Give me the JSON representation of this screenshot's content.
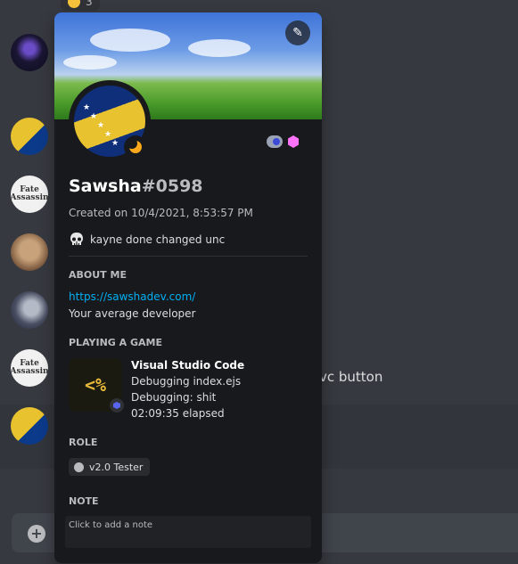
{
  "background": {
    "reaction_count": "3",
    "avatars": [
      "bosnia-flag-avatar",
      "dark-character-avatar",
      "fate-assassin-avatar",
      "cat-avatar",
      "person-avatar",
      "fate-assassin-avatar",
      "bosnia-flag-avatar"
    ],
    "partial_message_text": "vc button"
  },
  "profile": {
    "username": "Sawsha",
    "discriminator": "#0598",
    "created": "Created on 10/4/2021, 8:53:57 PM",
    "custom_status": "kayne done changed unc",
    "about_me_heading": "ABOUT ME",
    "about_link": "https://sawshadev.com/",
    "about_text": "Your average developer",
    "playing_heading": "PLAYING A GAME",
    "game": {
      "icon_text": "<%",
      "name": "Visual Studio Code",
      "details": "Debugging index.ejs",
      "state": "Debugging: shit",
      "elapsed": "02:09:35 elapsed"
    },
    "role_heading": "ROLE",
    "roles": [
      "v2.0 Tester"
    ],
    "note_heading": "NOTE",
    "note_placeholder": "Click to add a note",
    "status": "idle",
    "badges": [
      "hypesquad-icon",
      "boost-icon"
    ],
    "colors": {
      "link": "#00aff4",
      "idle": "#faa81a",
      "popout_bg": "#18191c",
      "game_text": "#e8b83a"
    }
  },
  "composer": {
    "plus_icon": "add-icon"
  }
}
